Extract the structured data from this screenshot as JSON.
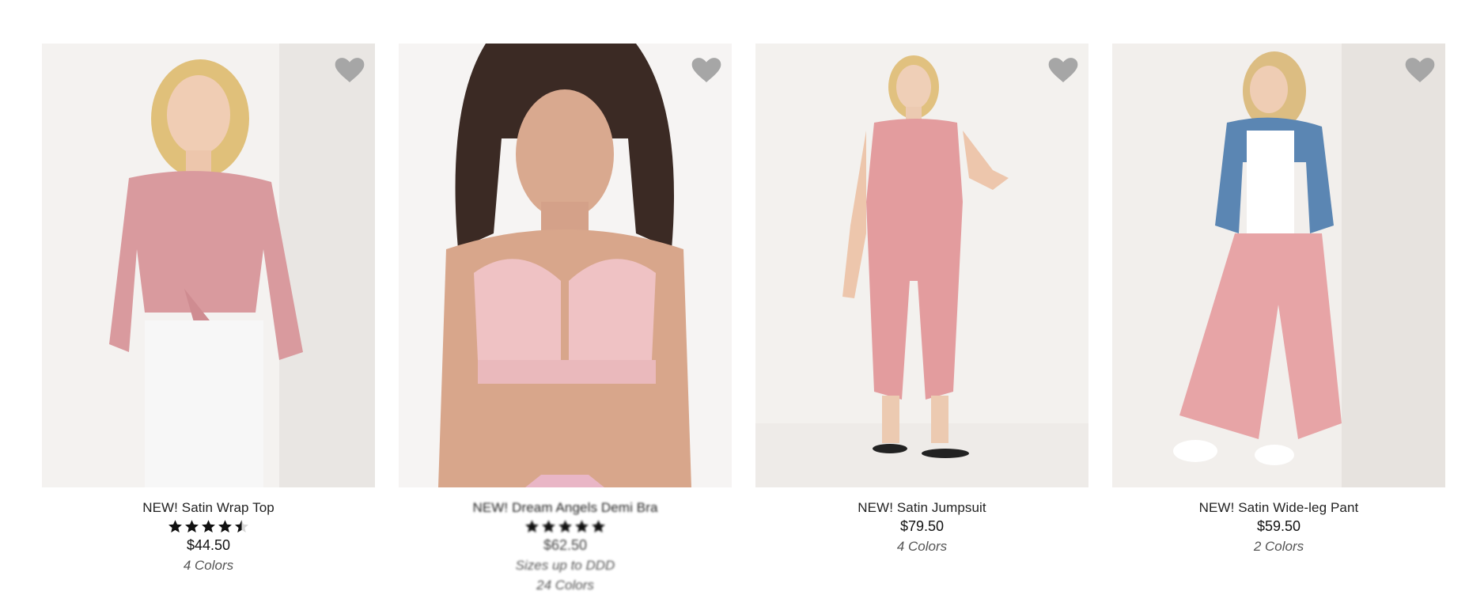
{
  "products": [
    {
      "name": "NEW! Satin Wrap Top",
      "rating": 4.5,
      "price": "$44.50",
      "colors": "4 Colors",
      "icon": "heart-icon",
      "accent": "#d99a9e"
    },
    {
      "name": "NEW! Dream Angels Demi Bra",
      "rating": 5,
      "price": "$62.50",
      "sizes": "Sizes up to DDD",
      "colors": "24 Colors",
      "icon": "heart-icon",
      "accent": "#efc2c4"
    },
    {
      "name": "NEW! Satin Jumpsuit",
      "price": "$79.50",
      "colors": "4 Colors",
      "icon": "heart-icon",
      "accent": "#e39c9e"
    },
    {
      "name": "NEW! Satin Wide-leg Pant",
      "price": "$59.50",
      "colors": "2 Colors",
      "icon": "heart-icon",
      "accent": "#e7a4a6"
    }
  ],
  "heart_color": "#a6a6a6",
  "star_color": "#111111"
}
